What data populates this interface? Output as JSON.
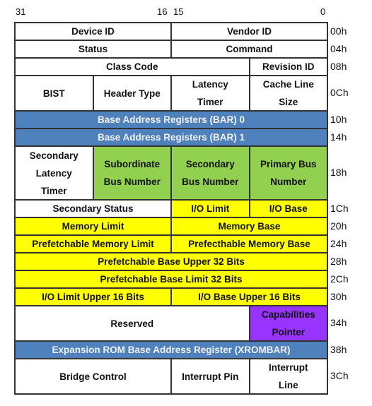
{
  "bit_labels": {
    "b31": "31",
    "b16": "16",
    "b15": "15",
    "b0": "0"
  },
  "colors": {
    "white": "#ffffff",
    "blue": "#4f81bd",
    "green": "#92d050",
    "yellow": "#ffff00",
    "purple": "#9933ff"
  },
  "rows": [
    {
      "offset": "00h",
      "cells": [
        {
          "label": "Device ID",
          "span": 2,
          "color": "white"
        },
        {
          "label": "Vendor ID",
          "span": 2,
          "color": "white"
        }
      ]
    },
    {
      "offset": "04h",
      "cells": [
        {
          "label": "Status",
          "span": 2,
          "color": "white"
        },
        {
          "label": "Command",
          "span": 2,
          "color": "white"
        }
      ]
    },
    {
      "offset": "08h",
      "cells": [
        {
          "label": "Class Code",
          "span": 3,
          "color": "white"
        },
        {
          "label": "Revision ID",
          "span": 1,
          "color": "white"
        }
      ]
    },
    {
      "offset": "0Ch",
      "cells": [
        {
          "label": "BIST",
          "span": 1,
          "color": "white"
        },
        {
          "label": "Header Type",
          "span": 1,
          "color": "white"
        },
        {
          "label": "Latency\nTimer",
          "span": 1,
          "color": "white"
        },
        {
          "label": "Cache Line\nSize",
          "span": 1,
          "color": "white"
        }
      ]
    },
    {
      "offset": "10h",
      "cells": [
        {
          "label": "Base Address Registers (BAR) 0",
          "span": 4,
          "color": "blue"
        }
      ]
    },
    {
      "offset": "14h",
      "cells": [
        {
          "label": "Base Address Registers (BAR) 1",
          "span": 4,
          "color": "blue"
        }
      ]
    },
    {
      "offset": "18h",
      "cells": [
        {
          "label": "Secondary\nLatency\nTimer",
          "span": 1,
          "color": "white"
        },
        {
          "label": "Subordinate\nBus Number",
          "span": 1,
          "color": "green"
        },
        {
          "label": "Secondary\nBus Number",
          "span": 1,
          "color": "green"
        },
        {
          "label": "Primary Bus\nNumber",
          "span": 1,
          "color": "green"
        }
      ]
    },
    {
      "offset": "1Ch",
      "cells": [
        {
          "label": "Secondary Status",
          "span": 2,
          "color": "white"
        },
        {
          "label": "I/O Limit",
          "span": 1,
          "color": "yellow"
        },
        {
          "label": "I/O Base",
          "span": 1,
          "color": "yellow"
        }
      ]
    },
    {
      "offset": "20h",
      "cells": [
        {
          "label": "Memory Limit",
          "span": 2,
          "color": "yellow"
        },
        {
          "label": "Memory Base",
          "span": 2,
          "color": "yellow"
        }
      ]
    },
    {
      "offset": "24h",
      "cells": [
        {
          "label": "Prefetchable Memory Limit",
          "span": 2,
          "color": "yellow"
        },
        {
          "label": "Prefecthable Memory Base",
          "span": 2,
          "color": "yellow"
        }
      ]
    },
    {
      "offset": "28h",
      "cells": [
        {
          "label": "Prefetchable Base Upper 32 Bits",
          "span": 4,
          "color": "yellow"
        }
      ]
    },
    {
      "offset": "2Ch",
      "cells": [
        {
          "label": "Prefetchable Base Limit 32 Bits",
          "span": 4,
          "color": "yellow"
        }
      ]
    },
    {
      "offset": "30h",
      "cells": [
        {
          "label": "I/O Limit Upper 16 Bits",
          "span": 2,
          "color": "yellow"
        },
        {
          "label": "I/O Base Upper 16 Bits",
          "span": 2,
          "color": "yellow"
        }
      ]
    },
    {
      "offset": "34h",
      "cells": [
        {
          "label": "Reserved",
          "span": 3,
          "color": "white"
        },
        {
          "label": "Capabilities\nPointer",
          "span": 1,
          "color": "purple"
        }
      ]
    },
    {
      "offset": "38h",
      "cells": [
        {
          "label": "Expansion ROM Base Address Register (XROMBAR)",
          "span": 4,
          "color": "blue"
        }
      ]
    },
    {
      "offset": "3Ch",
      "cells": [
        {
          "label": "Bridge Control",
          "span": 2,
          "color": "white"
        },
        {
          "label": "Interrupt Pin",
          "span": 1,
          "color": "white"
        },
        {
          "label": "Interrupt\nLine",
          "span": 1,
          "color": "white"
        }
      ]
    }
  ]
}
